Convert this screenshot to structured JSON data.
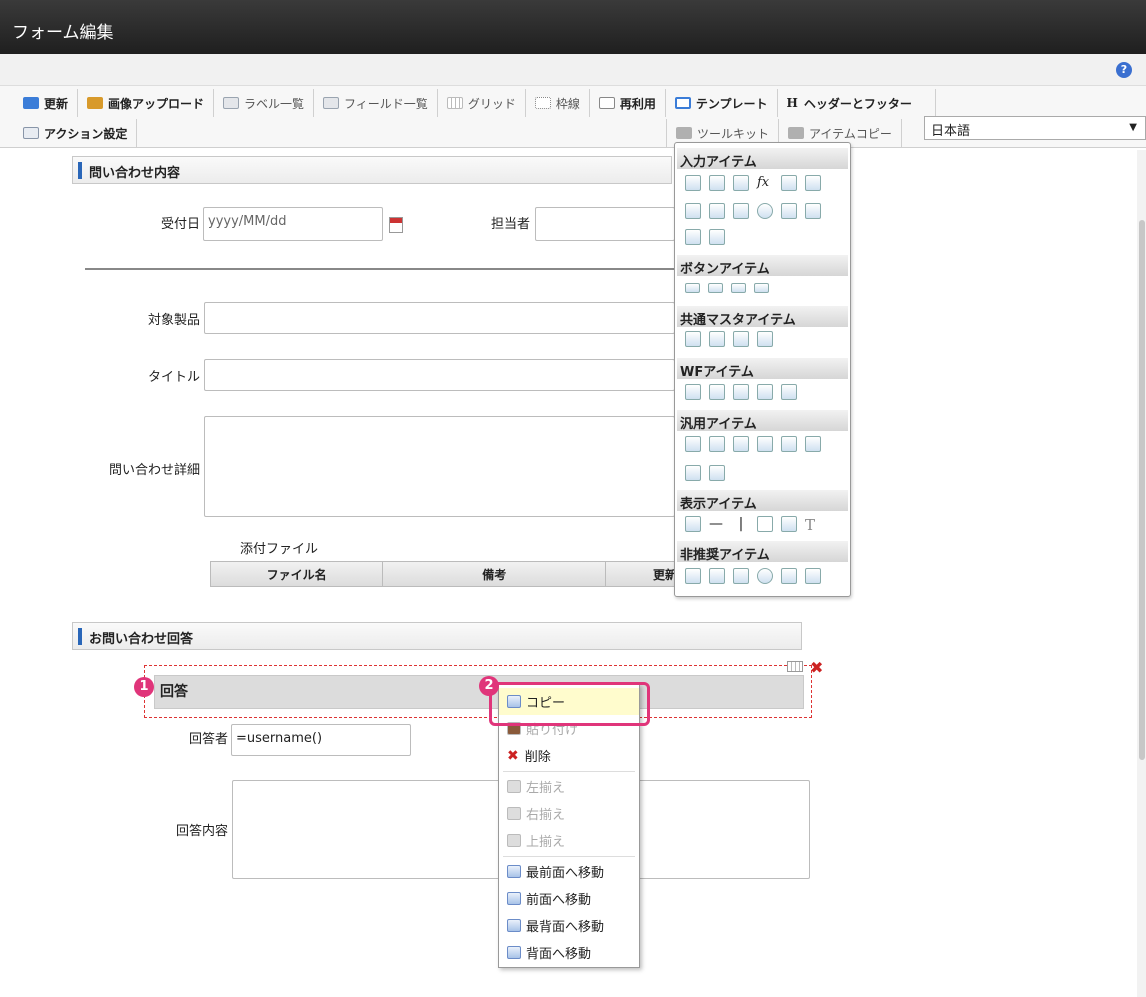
{
  "window": {
    "title": "フォーム編集",
    "help_icon": "?"
  },
  "toolbar": {
    "row1": [
      {
        "label": "更新",
        "icon": "update-icon",
        "color": "#3b7dd8"
      },
      {
        "label": "画像アップロード",
        "icon": "image-upload-icon",
        "color": "#d89a2b"
      },
      {
        "label": "ラベル一覧",
        "icon": "label-list-icon",
        "color": "#9aa4b0"
      },
      {
        "label": "フィールド一覧",
        "icon": "field-list-icon",
        "color": "#9aa4b0"
      },
      {
        "label": "グリッド",
        "icon": "grid-icon",
        "color": "#c8c8c8"
      },
      {
        "label": "枠線",
        "icon": "border-icon",
        "color": "#c8c8c8"
      },
      {
        "label": "再利用",
        "icon": "reuse-icon",
        "color": "#e8e8e8"
      },
      {
        "label": "テンプレート",
        "icon": "template-icon",
        "color": "#3b7dd8"
      },
      {
        "label": "ヘッダーとフッター",
        "icon": "header-footer-icon",
        "color": "#555555"
      }
    ],
    "row2_left": {
      "label": "アクション設定",
      "icon": "action-settings-icon"
    },
    "toolkit_label": "ツールキット",
    "item_copy_label": "アイテムコピー",
    "language": "日本語"
  },
  "form": {
    "section1_title": "問い合わせ内容",
    "received_date_label": "受付日",
    "received_date_placeholder": "yyyy/MM/dd",
    "person_label": "担当者",
    "product_label": "対象製品",
    "title_label": "タイトル",
    "details_label": "問い合わせ詳細",
    "attachment_label": "添付ファイル",
    "attachment_columns": [
      "ファイル名",
      "備考",
      "更新"
    ],
    "section2_title": "お問い合わせ回答",
    "answer_header": "回答",
    "answerer_label": "回答者",
    "answerer_value": "=username()",
    "answer_content_label": "回答内容"
  },
  "toolkit_panel": {
    "groups": [
      {
        "name": "入力アイテム"
      },
      {
        "name": "ボタンアイテム"
      },
      {
        "name": "共通マスタアイテム"
      },
      {
        "name": "WFアイテム"
      },
      {
        "name": "汎用アイテム"
      },
      {
        "name": "表示アイテム"
      },
      {
        "name": "非推奨アイテム"
      }
    ]
  },
  "context_menu": {
    "items": [
      {
        "label": "コピー",
        "state": "highlighted"
      },
      {
        "label": "貼り付け",
        "state": "disabled"
      },
      {
        "label": "削除",
        "state": "enabled"
      },
      {
        "label": "左揃え",
        "state": "disabled"
      },
      {
        "label": "右揃え",
        "state": "disabled"
      },
      {
        "label": "上揃え",
        "state": "disabled"
      },
      {
        "label": "最前面へ移動",
        "state": "enabled"
      },
      {
        "label": "前面へ移動",
        "state": "enabled"
      },
      {
        "label": "最背面へ移動",
        "state": "enabled"
      },
      {
        "label": "背面へ移動",
        "state": "enabled"
      }
    ]
  },
  "callouts": {
    "badge1": "1",
    "badge2": "2"
  },
  "colors": {
    "accent": "#e0357a",
    "titlebar": "#2a2a2a",
    "section_marker": "#2966b8"
  }
}
